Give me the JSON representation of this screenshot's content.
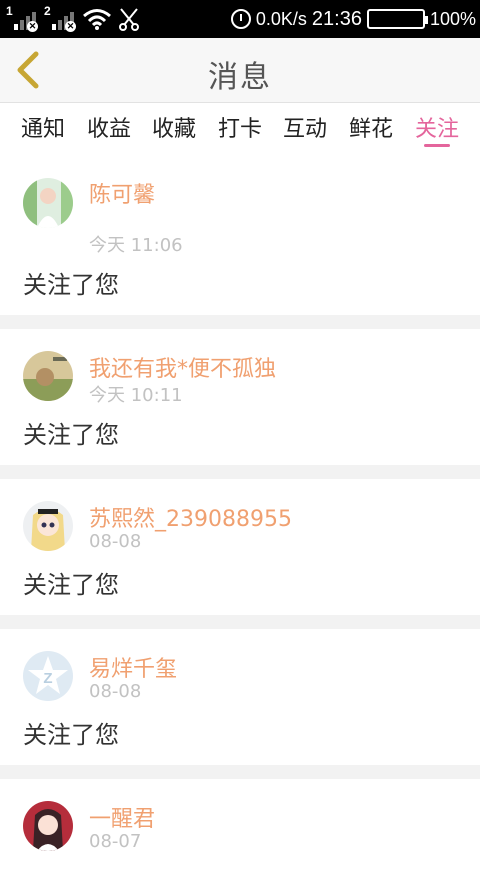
{
  "status_bar": {
    "sim1": "1",
    "sim2": "2",
    "network_speed": "0.0K/s",
    "time": "21:36",
    "battery": "100%"
  },
  "header": {
    "title": "消息"
  },
  "tabs": [
    "通知",
    "收益",
    "收藏",
    "打卡",
    "互动",
    "鲜花",
    "关注"
  ],
  "active_tab_index": 6,
  "colors": {
    "accent": "#e4659c",
    "username": "#f0a070",
    "back_icon": "#c7a634"
  },
  "notifications": [
    {
      "username": "陈可馨",
      "time": "今天 11:06",
      "content": "关注了您"
    },
    {
      "username": "我还有我*便不孤独",
      "time": "今天 10:11",
      "content": "关注了您"
    },
    {
      "username": "苏熙然_239088955",
      "time": "08-08",
      "content": "关注了您"
    },
    {
      "username": "易烊千玺",
      "time": "08-08",
      "content": "关注了您"
    },
    {
      "username": "一醒君",
      "time": "08-07",
      "content": ""
    }
  ]
}
